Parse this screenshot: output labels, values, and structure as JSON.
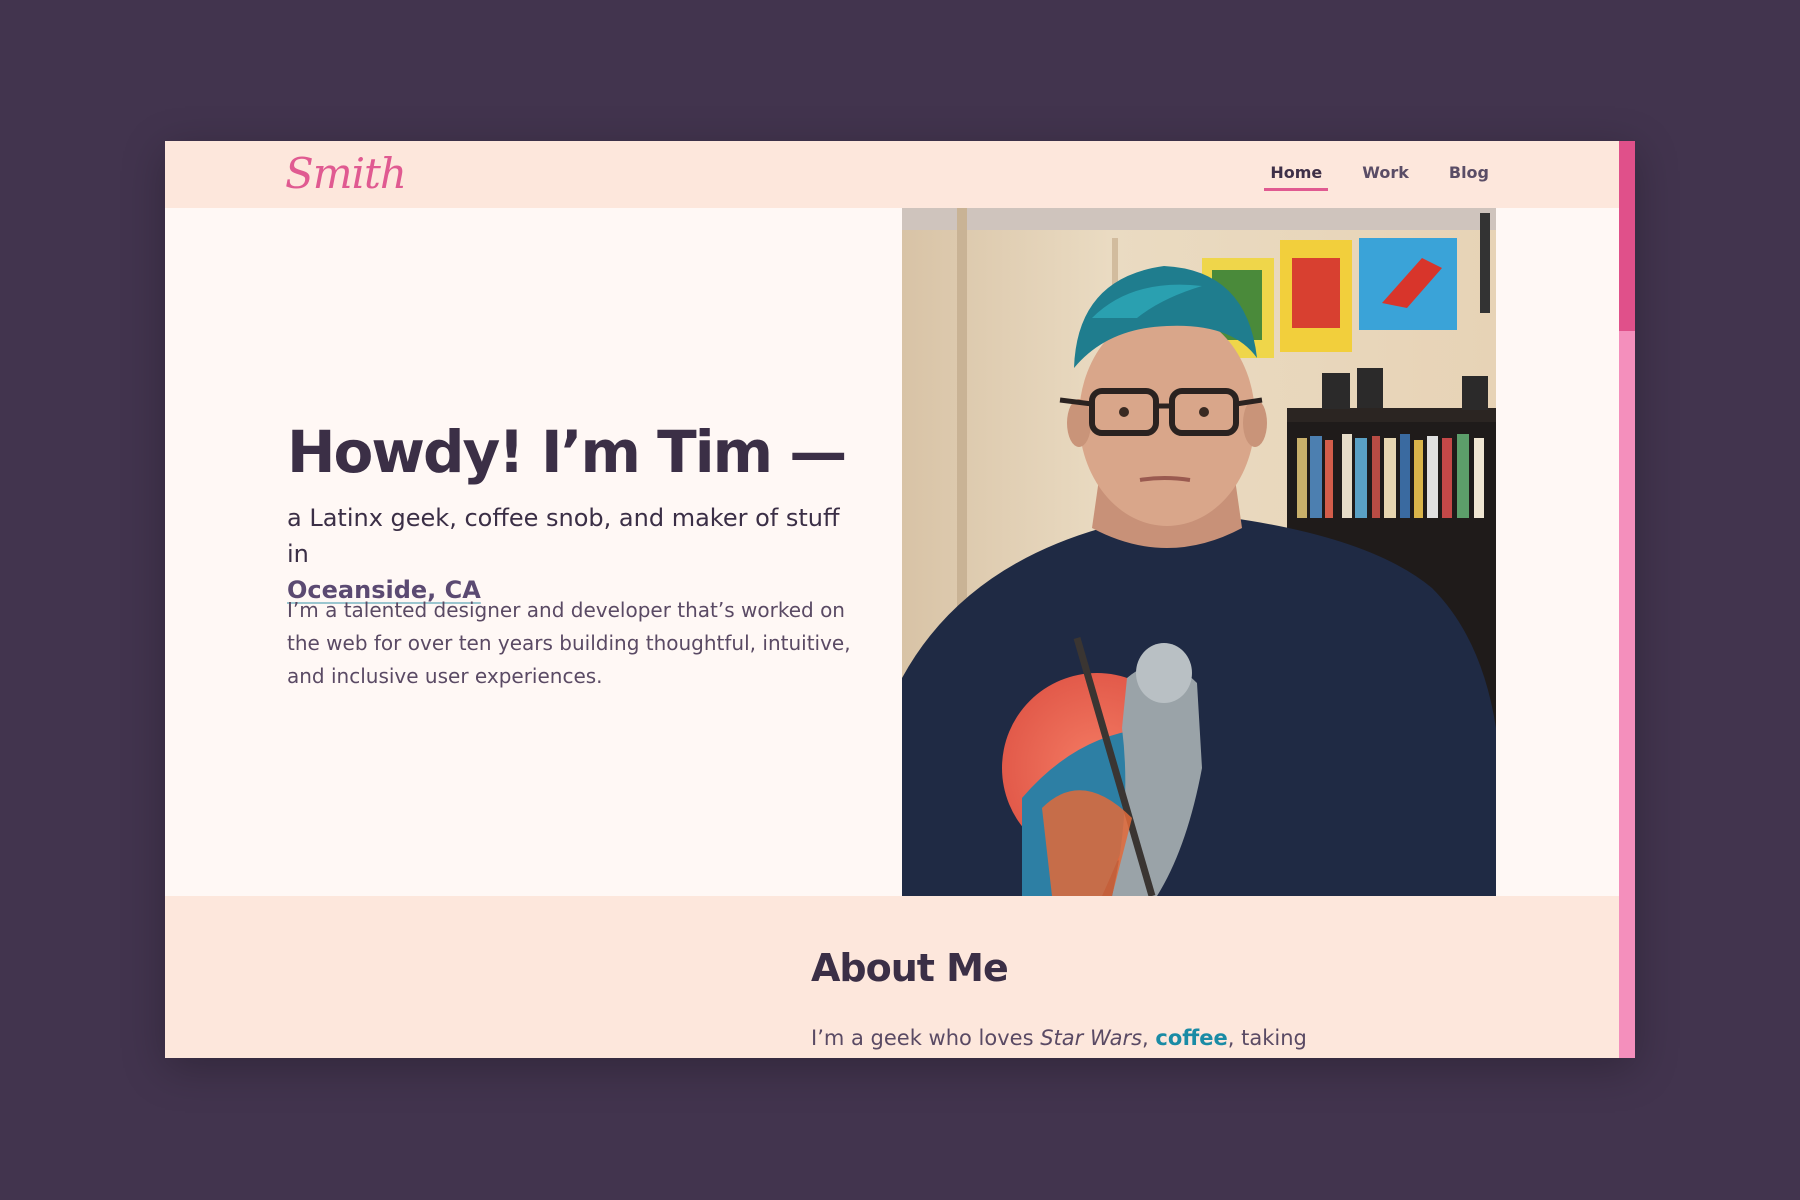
{
  "header": {
    "logo_text": "Smith",
    "nav": [
      {
        "label": "Home",
        "active": true
      },
      {
        "label": "Work",
        "active": false
      },
      {
        "label": "Blog",
        "active": false
      }
    ]
  },
  "hero": {
    "headline": "Howdy! I’m Tim —",
    "subline_text": "a Latinx geek, coffee snob, and maker of stuff in",
    "location_link": "Oceanside, CA",
    "description": "I’m a talented designer and developer that’s worked on the web for over ten years building thoughtful, intuitive, and inclusive user experiences."
  },
  "about": {
    "heading": "About Me",
    "text_start": "I’m a geek who loves ",
    "text_em": "Star Wars",
    "text_comma": ", ",
    "text_link": "coffee",
    "text_end": ", taking"
  },
  "colors": {
    "background": "#42344e",
    "accent_pink": "#e05a91",
    "header_bg": "#fde7dc",
    "page_bg": "#fff8f5",
    "link_teal": "#1a8ba5"
  }
}
